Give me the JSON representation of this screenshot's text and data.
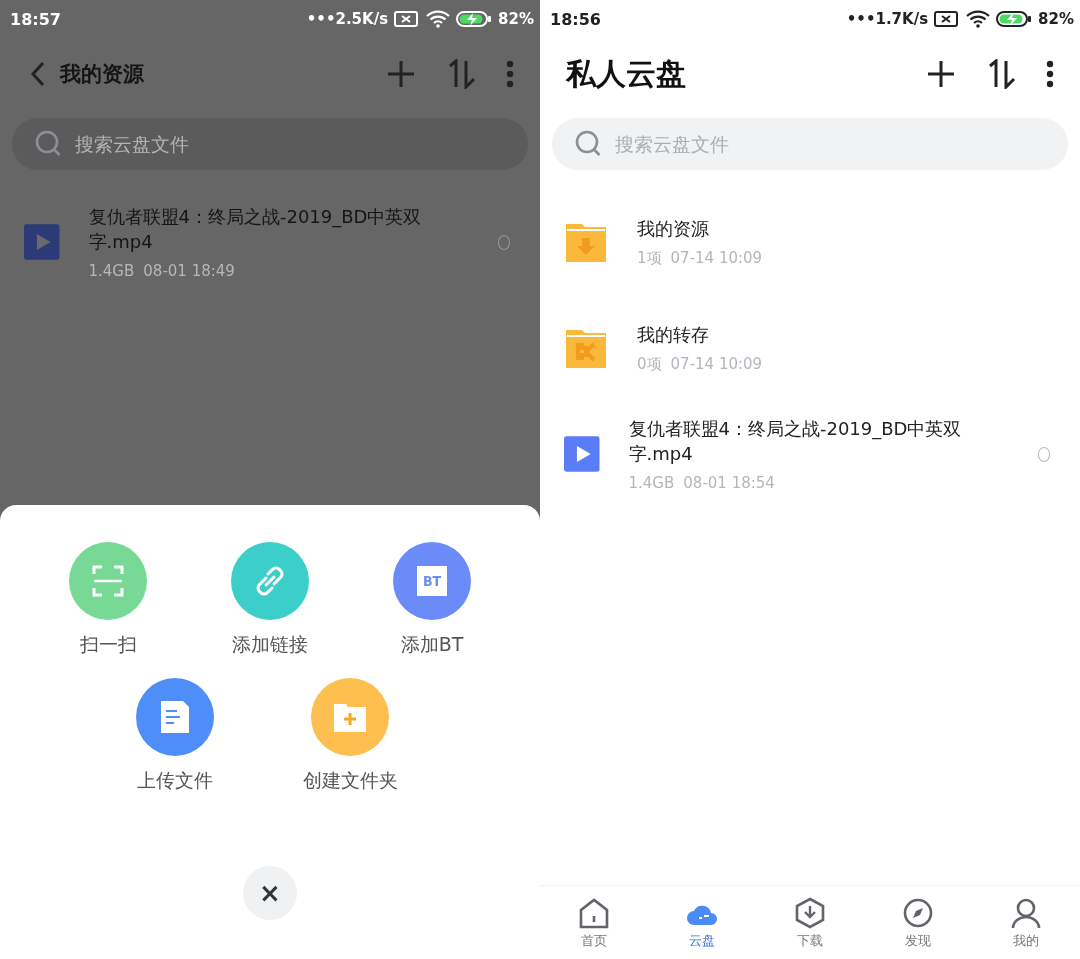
{
  "screens": [
    {
      "dimmed": true,
      "status_bar": {
        "time": "18:57",
        "speed": "•••2.5K/s",
        "battery": "82%"
      },
      "header": {
        "kind": "back",
        "title": "我的资源"
      },
      "search": {
        "placeholder": "搜索云盘文件"
      },
      "files": [
        {
          "kind": "video",
          "name": "复仇者联盟4：终局之战-2019_BD中英双字.mp4",
          "size": "1.4GB",
          "date": "08-01 18:49",
          "selected": false
        }
      ],
      "sheet": {
        "rows": [
          [
            {
              "kind": "scan",
              "label": "扫一扫",
              "color": "#78d896"
            },
            {
              "kind": "link",
              "label": "添加链接",
              "color": "#3ccfc9"
            },
            {
              "kind": "bt",
              "label": "添加BT",
              "icon_text": "BT",
              "color": "#6b8cf8"
            }
          ],
          [
            {
              "kind": "upload",
              "label": "上传文件",
              "color": "#4f8ef9"
            },
            {
              "kind": "folder",
              "label": "创建文件夹",
              "color": "#fdbf4f"
            }
          ]
        ],
        "close": "×"
      }
    },
    {
      "dimmed": false,
      "status_bar": {
        "time": "18:56",
        "speed": "•••1.7K/s",
        "battery": "82%"
      },
      "header": {
        "kind": "root",
        "title": "私人云盘"
      },
      "search": {
        "placeholder": "搜索云盘文件"
      },
      "files": [
        {
          "kind": "folder-download",
          "name": "我的资源",
          "size": "1项",
          "date": "07-14 10:09"
        },
        {
          "kind": "folder-transfer",
          "name": "我的转存",
          "size": "0项",
          "date": "07-14 10:09"
        },
        {
          "kind": "video",
          "name": "复仇者联盟4：终局之战-2019_BD中英双字.mp4",
          "size": "1.4GB",
          "date": "08-01 18:54",
          "selected": false
        }
      ],
      "tabs": [
        {
          "kind": "home",
          "label": "首页",
          "selected": false
        },
        {
          "kind": "cloud",
          "label": "云盘",
          "selected": true
        },
        {
          "kind": "download",
          "label": "下载",
          "selected": false
        },
        {
          "kind": "discover",
          "label": "发现",
          "selected": false
        },
        {
          "kind": "me",
          "label": "我的",
          "selected": false
        }
      ]
    }
  ]
}
